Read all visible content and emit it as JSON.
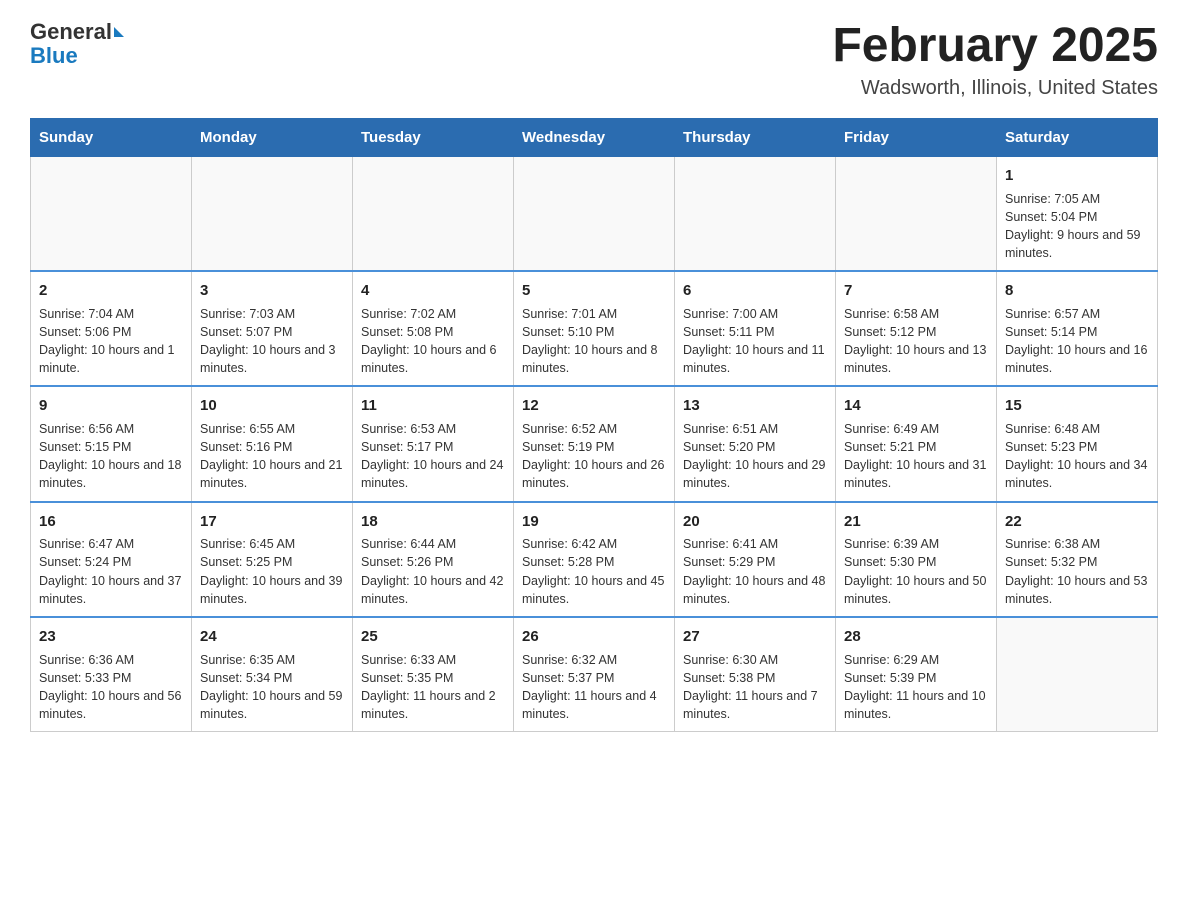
{
  "header": {
    "logo_general": "General",
    "logo_blue": "Blue",
    "month_title": "February 2025",
    "location": "Wadsworth, Illinois, United States"
  },
  "days_of_week": [
    "Sunday",
    "Monday",
    "Tuesday",
    "Wednesday",
    "Thursday",
    "Friday",
    "Saturday"
  ],
  "weeks": [
    {
      "days": [
        {
          "number": "",
          "info": ""
        },
        {
          "number": "",
          "info": ""
        },
        {
          "number": "",
          "info": ""
        },
        {
          "number": "",
          "info": ""
        },
        {
          "number": "",
          "info": ""
        },
        {
          "number": "",
          "info": ""
        },
        {
          "number": "1",
          "info": "Sunrise: 7:05 AM\nSunset: 5:04 PM\nDaylight: 9 hours and 59 minutes."
        }
      ]
    },
    {
      "days": [
        {
          "number": "2",
          "info": "Sunrise: 7:04 AM\nSunset: 5:06 PM\nDaylight: 10 hours and 1 minute."
        },
        {
          "number": "3",
          "info": "Sunrise: 7:03 AM\nSunset: 5:07 PM\nDaylight: 10 hours and 3 minutes."
        },
        {
          "number": "4",
          "info": "Sunrise: 7:02 AM\nSunset: 5:08 PM\nDaylight: 10 hours and 6 minutes."
        },
        {
          "number": "5",
          "info": "Sunrise: 7:01 AM\nSunset: 5:10 PM\nDaylight: 10 hours and 8 minutes."
        },
        {
          "number": "6",
          "info": "Sunrise: 7:00 AM\nSunset: 5:11 PM\nDaylight: 10 hours and 11 minutes."
        },
        {
          "number": "7",
          "info": "Sunrise: 6:58 AM\nSunset: 5:12 PM\nDaylight: 10 hours and 13 minutes."
        },
        {
          "number": "8",
          "info": "Sunrise: 6:57 AM\nSunset: 5:14 PM\nDaylight: 10 hours and 16 minutes."
        }
      ]
    },
    {
      "days": [
        {
          "number": "9",
          "info": "Sunrise: 6:56 AM\nSunset: 5:15 PM\nDaylight: 10 hours and 18 minutes."
        },
        {
          "number": "10",
          "info": "Sunrise: 6:55 AM\nSunset: 5:16 PM\nDaylight: 10 hours and 21 minutes."
        },
        {
          "number": "11",
          "info": "Sunrise: 6:53 AM\nSunset: 5:17 PM\nDaylight: 10 hours and 24 minutes."
        },
        {
          "number": "12",
          "info": "Sunrise: 6:52 AM\nSunset: 5:19 PM\nDaylight: 10 hours and 26 minutes."
        },
        {
          "number": "13",
          "info": "Sunrise: 6:51 AM\nSunset: 5:20 PM\nDaylight: 10 hours and 29 minutes."
        },
        {
          "number": "14",
          "info": "Sunrise: 6:49 AM\nSunset: 5:21 PM\nDaylight: 10 hours and 31 minutes."
        },
        {
          "number": "15",
          "info": "Sunrise: 6:48 AM\nSunset: 5:23 PM\nDaylight: 10 hours and 34 minutes."
        }
      ]
    },
    {
      "days": [
        {
          "number": "16",
          "info": "Sunrise: 6:47 AM\nSunset: 5:24 PM\nDaylight: 10 hours and 37 minutes."
        },
        {
          "number": "17",
          "info": "Sunrise: 6:45 AM\nSunset: 5:25 PM\nDaylight: 10 hours and 39 minutes."
        },
        {
          "number": "18",
          "info": "Sunrise: 6:44 AM\nSunset: 5:26 PM\nDaylight: 10 hours and 42 minutes."
        },
        {
          "number": "19",
          "info": "Sunrise: 6:42 AM\nSunset: 5:28 PM\nDaylight: 10 hours and 45 minutes."
        },
        {
          "number": "20",
          "info": "Sunrise: 6:41 AM\nSunset: 5:29 PM\nDaylight: 10 hours and 48 minutes."
        },
        {
          "number": "21",
          "info": "Sunrise: 6:39 AM\nSunset: 5:30 PM\nDaylight: 10 hours and 50 minutes."
        },
        {
          "number": "22",
          "info": "Sunrise: 6:38 AM\nSunset: 5:32 PM\nDaylight: 10 hours and 53 minutes."
        }
      ]
    },
    {
      "days": [
        {
          "number": "23",
          "info": "Sunrise: 6:36 AM\nSunset: 5:33 PM\nDaylight: 10 hours and 56 minutes."
        },
        {
          "number": "24",
          "info": "Sunrise: 6:35 AM\nSunset: 5:34 PM\nDaylight: 10 hours and 59 minutes."
        },
        {
          "number": "25",
          "info": "Sunrise: 6:33 AM\nSunset: 5:35 PM\nDaylight: 11 hours and 2 minutes."
        },
        {
          "number": "26",
          "info": "Sunrise: 6:32 AM\nSunset: 5:37 PM\nDaylight: 11 hours and 4 minutes."
        },
        {
          "number": "27",
          "info": "Sunrise: 6:30 AM\nSunset: 5:38 PM\nDaylight: 11 hours and 7 minutes."
        },
        {
          "number": "28",
          "info": "Sunrise: 6:29 AM\nSunset: 5:39 PM\nDaylight: 11 hours and 10 minutes."
        },
        {
          "number": "",
          "info": ""
        }
      ]
    }
  ]
}
